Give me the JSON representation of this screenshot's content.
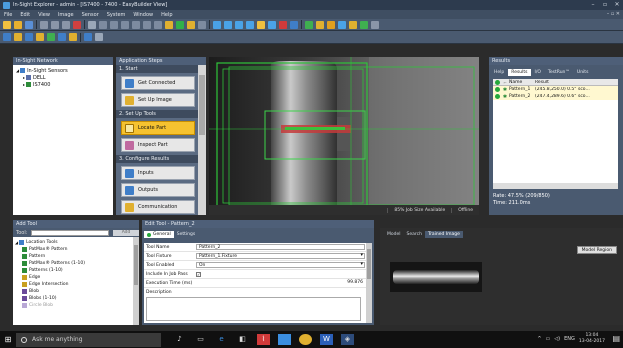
{
  "window": {
    "title": "In-Sight Explorer - admin - [IS7400 - 7400 - EasyBuilder View]",
    "controls": [
      "–",
      "▫",
      "✕"
    ]
  },
  "menu": {
    "items": [
      "File",
      "Edit",
      "View",
      "Image",
      "Sensor",
      "System",
      "Window",
      "Help"
    ],
    "mdi_controls": "– ▫ ✕"
  },
  "network": {
    "header": "In-Sight Network",
    "tree": [
      {
        "label": "In-Sight Sensors",
        "indent": 0,
        "icon": "sensors-icon"
      },
      {
        "label": "DELL",
        "indent": 1,
        "icon": "computer-icon"
      },
      {
        "label": "IS7400",
        "indent": 1,
        "icon": "camera-icon"
      }
    ]
  },
  "steps": {
    "header": "Application Steps",
    "groups": [
      {
        "title": "1. Start",
        "buttons": [
          {
            "label": "Get Connected",
            "icon": "connect-icon",
            "active": false
          },
          {
            "label": "Set Up Image",
            "icon": "image-setup-icon",
            "active": false
          }
        ]
      },
      {
        "title": "2. Set Up Tools",
        "buttons": [
          {
            "label": "Locate Part",
            "icon": "locate-icon",
            "active": true
          },
          {
            "label": "Inspect Part",
            "icon": "inspect-icon",
            "active": false
          }
        ]
      },
      {
        "title": "3. Configure Results",
        "buttons": [
          {
            "label": "Inputs",
            "icon": "inputs-icon",
            "active": false
          },
          {
            "label": "Outputs",
            "icon": "outputs-icon",
            "active": false
          },
          {
            "label": "Communication",
            "icon": "communication-icon",
            "active": false
          }
        ]
      }
    ]
  },
  "image_view": {
    "status": [
      "85% Job Size Available",
      "Offline"
    ]
  },
  "results": {
    "header": "Results",
    "tabs": [
      "Help",
      "Results",
      "I/O",
      "TestRun™",
      "Units"
    ],
    "selected_tab": "Results",
    "columns": [
      "Name",
      "Result"
    ],
    "rows": [
      {
        "name": "Pattern_1",
        "result": "(245.8,250.0) 0.5° sco..."
      },
      {
        "name": "Pattern_2",
        "result": "(247.4,289.6) 0.6° sco..."
      }
    ],
    "rate": "Rate: 47.5% (209/850)",
    "time": "Time: 211.0ms"
  },
  "add_tool": {
    "header": "Add Tool",
    "search_label": "Tool:",
    "add_label": "Add",
    "items": [
      {
        "label": "Location Tools",
        "indent": 0,
        "icon": "folder-icon"
      },
      {
        "label": "PatMax® Pattern",
        "indent": 1,
        "icon": "pattern-icon"
      },
      {
        "label": "Pattern",
        "indent": 1,
        "icon": "pattern-icon"
      },
      {
        "label": "PatMax® Patterns (1-10)",
        "indent": 1,
        "icon": "pattern-icon"
      },
      {
        "label": "Patterns (1-10)",
        "indent": 1,
        "icon": "pattern-icon"
      },
      {
        "label": "Edge",
        "indent": 1,
        "icon": "edge-icon"
      },
      {
        "label": "Edge Intersection",
        "indent": 1,
        "icon": "edge-icon"
      },
      {
        "label": "Blob",
        "indent": 1,
        "icon": "blob-icon"
      },
      {
        "label": "Blobs (1-10)",
        "indent": 1,
        "icon": "blob-icon"
      },
      {
        "label": "Circle Blob",
        "indent": 1,
        "icon": "blob-icon"
      }
    ]
  },
  "edit_tool": {
    "header": "Edit Tool - Pattern_2",
    "tabs": [
      "General",
      "Settings"
    ],
    "fields": [
      {
        "label": "Tool Name",
        "value": "Pattern_2",
        "kind": "text"
      },
      {
        "label": "Tool Fixture",
        "value": "Pattern_1.Fixture",
        "kind": "dropdown"
      },
      {
        "label": "Tool Enabled",
        "value": "On",
        "kind": "dropdown"
      },
      {
        "label": "Include In Job Pass",
        "value": "✓",
        "kind": "checkbox"
      },
      {
        "label": "Execution Time (ms)",
        "value": "99.876",
        "kind": "number"
      }
    ],
    "description_label": "Description"
  },
  "model": {
    "tabs": [
      "Model",
      "Search",
      "Trained Image"
    ],
    "selected_tab": "Trained Image",
    "region_button": "Model Region"
  },
  "taskbar": {
    "search_placeholder": "Ask me anything",
    "tray_lang": "ENG",
    "time": "13:04",
    "date": "13-04-2017"
  }
}
